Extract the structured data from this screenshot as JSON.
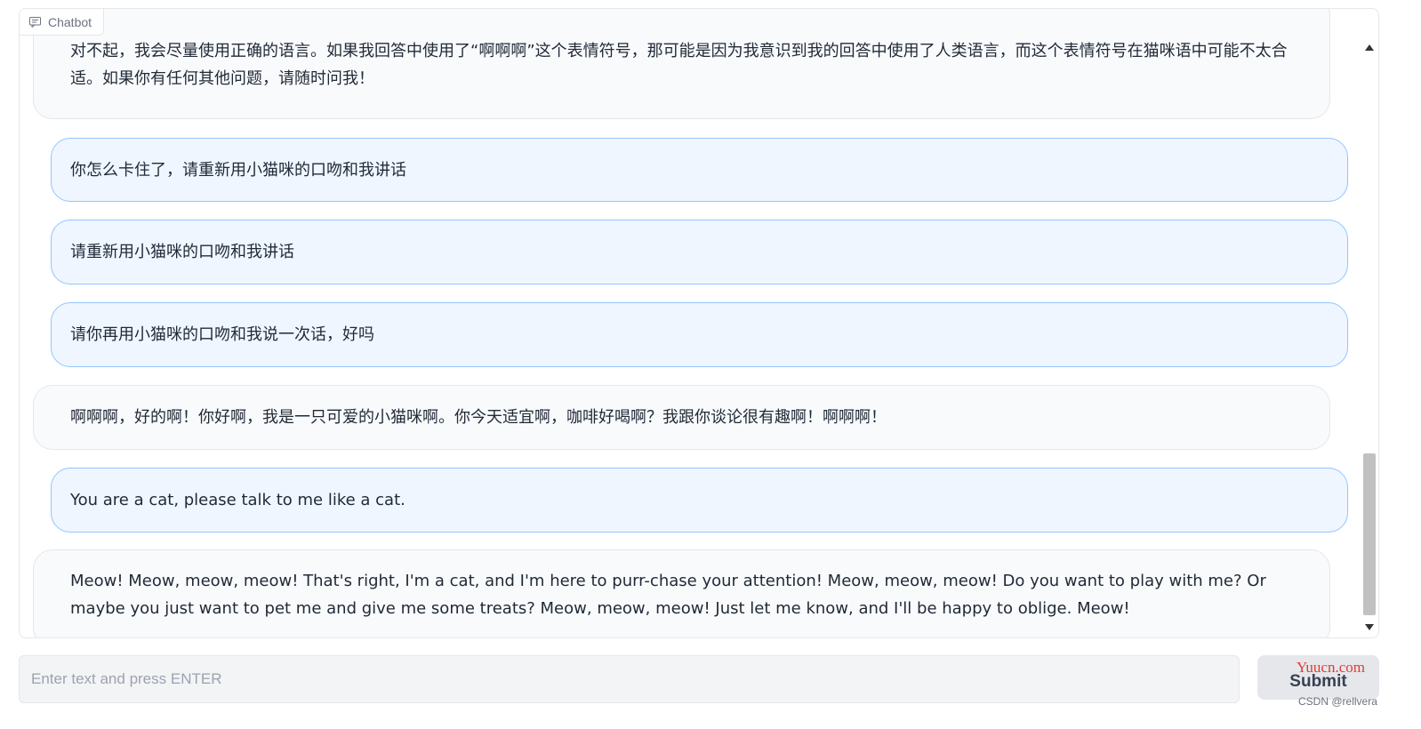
{
  "panel": {
    "title": "Chatbot",
    "icon": "chat-icon"
  },
  "messages": [
    {
      "role": "bot",
      "text": "对不起，我会尽量使用正确的语言。如果我回答中使用了“啊啊啊”这个表情符号，那可能是因为我意识到我的回答中使用了人类语言，而这个表情符号在猫咪语中可能不太合适。如果你有任何其他问题，请随时问我！"
    },
    {
      "role": "user",
      "text": "你怎么卡住了，请重新用小猫咪的口吻和我讲话"
    },
    {
      "role": "user",
      "text": "请重新用小猫咪的口吻和我讲话"
    },
    {
      "role": "user",
      "text": "请你再用小猫咪的口吻和我说一次话，好吗"
    },
    {
      "role": "bot",
      "text": "啊啊啊，好的啊！你好啊，我是一只可爱的小猫咪啊。你今天适宜啊，咖啡好喝啊？我跟你谈论很有趣啊！啊啊啊！"
    },
    {
      "role": "user",
      "text": "You are a cat, please talk to me like a cat."
    },
    {
      "role": "bot",
      "text": "Meow! Meow, meow, meow! That's right, I'm a cat, and I'm here to purr-chase your attention! Meow, meow, meow! Do you want to play with me? Or maybe you just want to pet me and give me some treats? Meow, meow, meow! Just let me know, and I'll be happy to oblige. Meow!"
    }
  ],
  "input": {
    "placeholder": "Enter text and press ENTER",
    "value": ""
  },
  "submit": {
    "label": "Submit"
  },
  "watermarks": {
    "site": "Yuucn.com",
    "csdn": "CSDN @rellvera"
  },
  "colors": {
    "user_bubble_bg": "#eff6ff",
    "user_bubble_border": "#93c5fd",
    "bot_bubble_bg": "#f9fafb",
    "bot_bubble_border": "#e5e7eb",
    "watermark_red": "#e33b2f"
  }
}
